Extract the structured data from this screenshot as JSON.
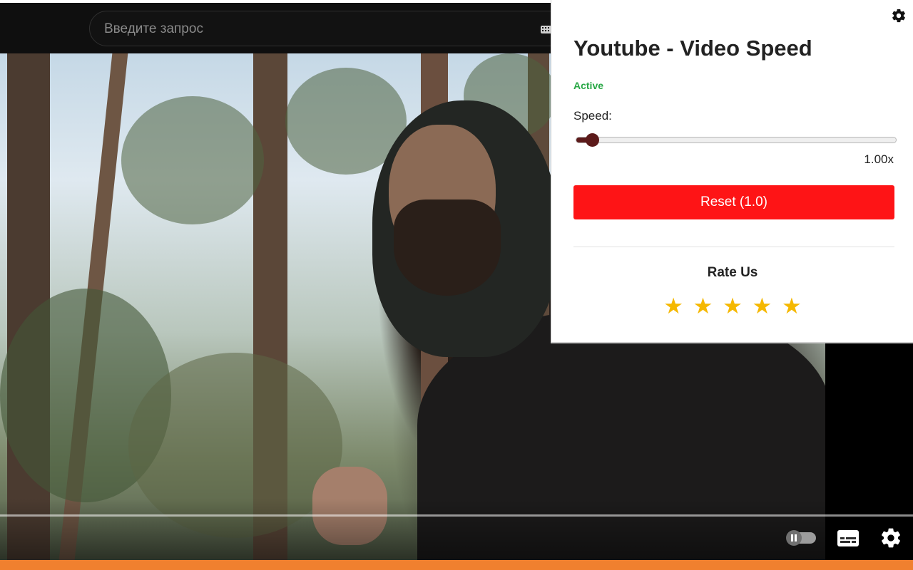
{
  "search": {
    "placeholder": "Введите запрос"
  },
  "icons": {
    "keyboard": "keyboard-icon",
    "autoplay": "autoplay-toggle-icon",
    "subtitles": "subtitles-icon",
    "player_settings": "gear-icon",
    "popup_settings": "gear-icon",
    "star": "star-icon"
  },
  "extension": {
    "title": "Youtube - Video Speed",
    "status": "Active",
    "speed_label": "Speed:",
    "speed_value": "1.00x",
    "speed_fraction": 0.05,
    "reset_label": "Reset (1.0)",
    "rate_title": "Rate Us",
    "stars": [
      "★",
      "★",
      "★",
      "★",
      "★"
    ]
  },
  "colors": {
    "accent_red": "#fe1416",
    "status_green": "#28a745",
    "slider_thumb": "#5c1a1a",
    "star_gold": "#f5b800",
    "bottom_bar": "#f0802f",
    "masthead": "#0f0f0f"
  }
}
